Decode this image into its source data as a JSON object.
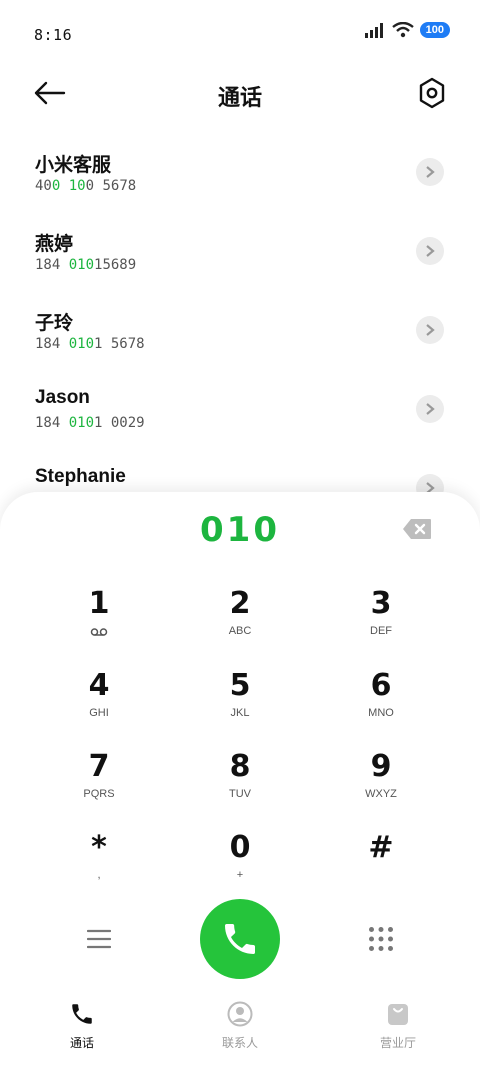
{
  "status_bar": {
    "time": "8:16",
    "battery": "100"
  },
  "header": {
    "title": "通话"
  },
  "contacts": [
    {
      "name": "小米客服",
      "num_parts": [
        "40",
        "0",
        " ",
        "10",
        "0",
        " 5678"
      ]
    },
    {
      "name": "燕婷",
      "num_parts": [
        "184 ",
        "010",
        "15689",
        "",
        "",
        ""
      ]
    },
    {
      "name": "子玲",
      "num_parts": [
        "184 ",
        "010",
        "1 5678",
        "",
        "",
        ""
      ]
    },
    {
      "name": "Jason",
      "num_parts": [
        "184 ",
        "010",
        "1 0029",
        "",
        "",
        ""
      ]
    },
    {
      "name": "Stephanie",
      "num_parts": [
        "",
        "",
        "",
        "",
        "",
        ""
      ]
    }
  ],
  "dialer": {
    "entered": "010",
    "keys": [
      {
        "digit": "1",
        "letters": ""
      },
      {
        "digit": "2",
        "letters": "ABC"
      },
      {
        "digit": "3",
        "letters": "DEF"
      },
      {
        "digit": "4",
        "letters": "GHI"
      },
      {
        "digit": "5",
        "letters": "JKL"
      },
      {
        "digit": "6",
        "letters": "MNO"
      },
      {
        "digit": "7",
        "letters": "PQRS"
      },
      {
        "digit": "8",
        "letters": "TUV"
      },
      {
        "digit": "9",
        "letters": "WXYZ"
      },
      {
        "digit": "*",
        "letters": ","
      },
      {
        "digit": "0",
        "letters": "+"
      },
      {
        "digit": "#",
        "letters": ""
      }
    ]
  },
  "tabs": [
    {
      "label": "通话",
      "icon": "phone-icon",
      "active": true
    },
    {
      "label": "联系人",
      "icon": "person-icon",
      "active": false
    },
    {
      "label": "营业厅",
      "icon": "bag-icon",
      "active": false
    }
  ],
  "colors": {
    "accent": "#1db53f",
    "call": "#25c43b",
    "battery": "#1e7cf5"
  }
}
